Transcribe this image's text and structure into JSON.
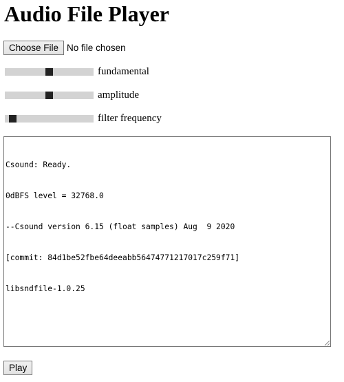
{
  "page": {
    "title": "Audio File Player"
  },
  "file_input": {
    "button_label": "Choose File",
    "status": "No file chosen"
  },
  "sliders": [
    {
      "label": "fundamental",
      "value_fraction": 0.5
    },
    {
      "label": "amplitude",
      "value_fraction": 0.5
    },
    {
      "label": "filter frequency",
      "value_fraction": 0.05
    }
  ],
  "console": {
    "lines": [
      "Csound: Ready.",
      "0dBFS level = 32768.0",
      "--Csound version 6.15 (float samples) Aug  9 2020",
      "[commit: 84d1be52fbe64deeabb56474771217017c259f71]",
      "libsndfile-1.0.25"
    ]
  },
  "play_button": {
    "label": "Play"
  }
}
